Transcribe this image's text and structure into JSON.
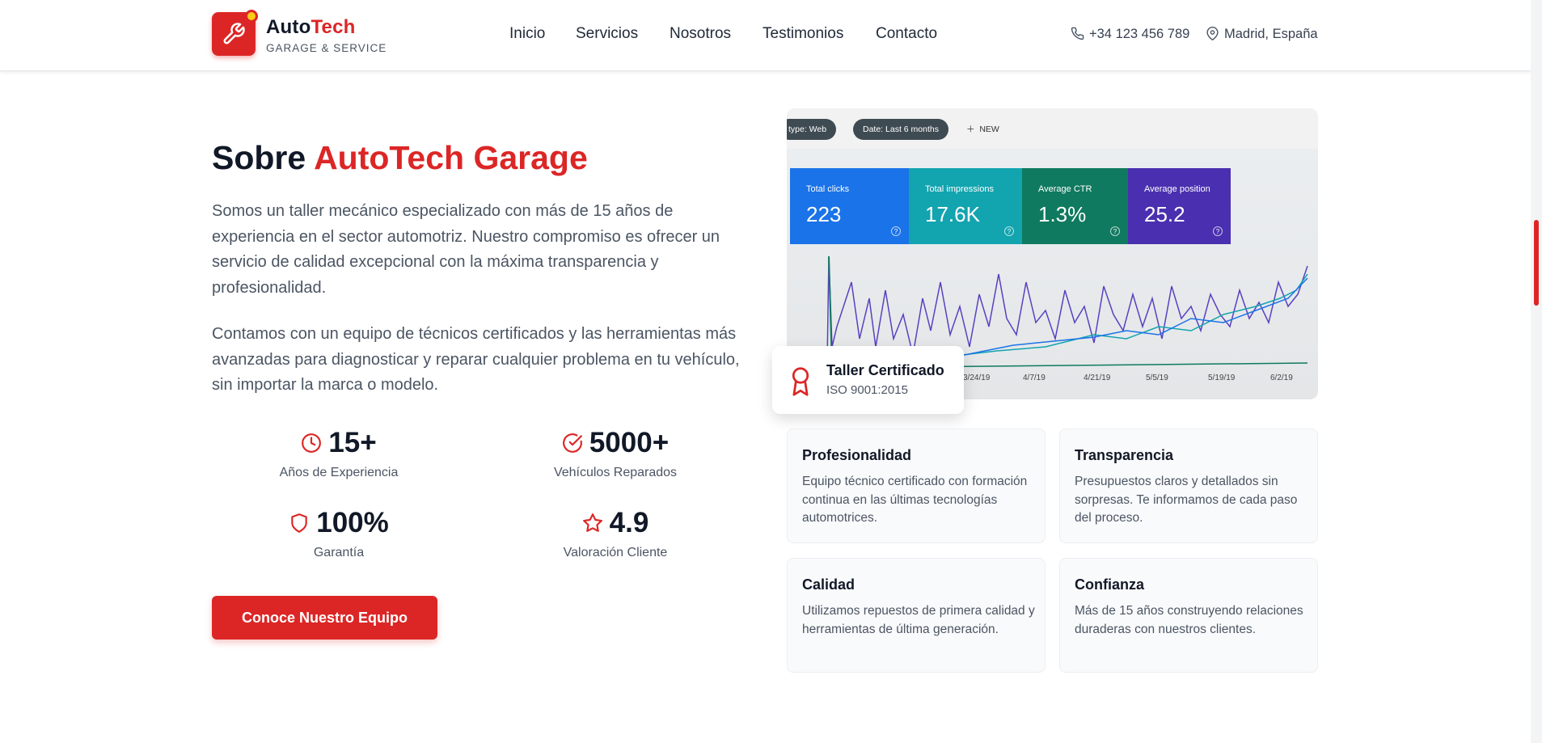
{
  "header": {
    "brand_main": "Auto",
    "brand_accent": "Tech",
    "brand_sub": "GARAGE & SERVICE",
    "icons": {
      "logo": "wrench-icon",
      "phone": "phone-icon",
      "location": "map-pin-icon"
    },
    "nav": [
      {
        "label": "Inicio"
      },
      {
        "label": "Servicios"
      },
      {
        "label": "Nosotros"
      },
      {
        "label": "Testimonios"
      },
      {
        "label": "Contacto"
      }
    ],
    "phone": "+34 123 456 789",
    "location": "Madrid, España"
  },
  "about": {
    "title_main": "Sobre ",
    "title_accent": "AutoTech Garage",
    "paragraph_1": "Somos un taller mecánico especializado con más de 15 años de experiencia en el sector automotriz. Nuestro compromiso es ofrecer un servicio de calidad excepcional con la máxima transparencia y profesionalidad.",
    "paragraph_2": "Contamos con un equipo de técnicos certificados y las herramientas más avanzadas para diagnosticar y reparar cualquier problema en tu vehículo, sin importar la marca o modelo.",
    "stats": [
      {
        "value": "15+",
        "label": "Años de Experiencia",
        "icon": "clock-icon"
      },
      {
        "value": "5000+",
        "label": "Vehículos Reparados",
        "icon": "check-circle-icon"
      },
      {
        "value": "100%",
        "label": "Garantía",
        "icon": "shield-icon"
      },
      {
        "value": "4.9",
        "label": "Valoración Cliente",
        "icon": "star-icon"
      }
    ],
    "cta_label": "Conoce Nuestro Equipo"
  },
  "dashboard": {
    "chips": [
      "type: Web",
      "Date: Last 6 months"
    ],
    "new_label": "NEW",
    "tiles": [
      {
        "label": "Total clicks",
        "value": "223",
        "color": "#1a73e8"
      },
      {
        "label": "Total impressions",
        "value": "17.6K",
        "color": "#12a4af"
      },
      {
        "label": "Average CTR",
        "value": "1.3%",
        "color": "#0f7a5f"
      },
      {
        "label": "Average position",
        "value": "25.2",
        "color": "#4a30b0"
      }
    ],
    "dates": [
      "3/24/19",
      "4/7/19",
      "4/21/19",
      "5/5/19",
      "5/19/19",
      "6/2/19"
    ]
  },
  "badge": {
    "title": "Taller Certificado",
    "subtitle": "ISO 9001:2015",
    "icon": "award-icon"
  },
  "values": [
    {
      "title": "Profesionalidad",
      "desc": "Equipo técnico certificado con formación continua en las últimas tecnologías automotrices."
    },
    {
      "title": "Transparencia",
      "desc": "Presupuestos claros y detallados sin sorpresas. Te informamos de cada paso del proceso."
    },
    {
      "title": "Calidad",
      "desc": "Utilizamos repuestos de primera calidad y herramientas de última generación."
    },
    {
      "title": "Confianza",
      "desc": "Más de 15 años construyendo relaciones duraderas con nuestros clientes."
    }
  ],
  "colors": {
    "accent": "#dc2626",
    "dark": "#111827",
    "muted": "#4b5563"
  }
}
